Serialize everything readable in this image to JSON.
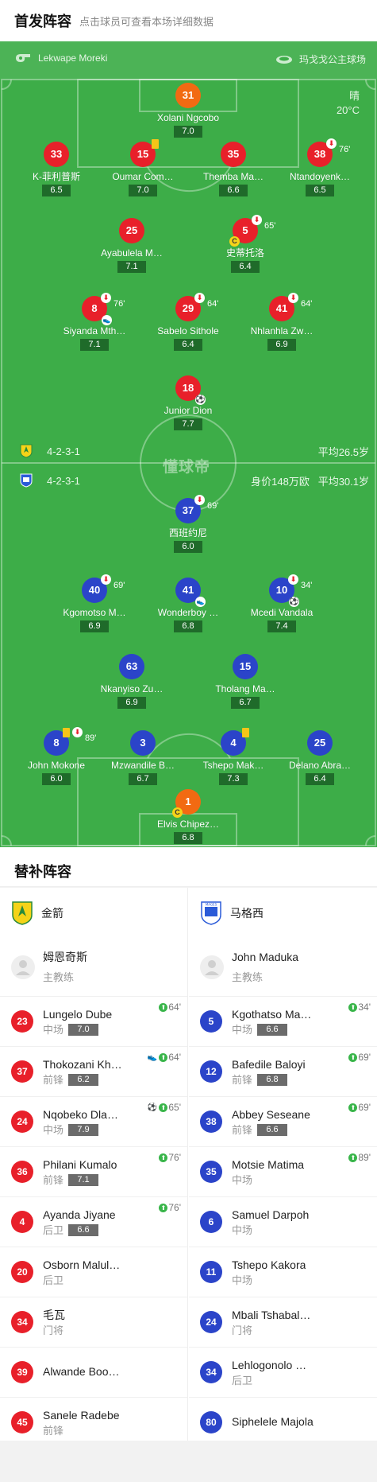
{
  "header": {
    "title": "首发阵容",
    "subtitle": "点击球员可查看本场详细数据"
  },
  "match_info": {
    "referee": "Lekwape Moreki",
    "venue": "玛戈戈公主球场",
    "weather": "晴",
    "temperature": "20°C"
  },
  "watermark": "懂球帝",
  "home": {
    "formation": "4-2-3-1",
    "avg_age": "平均26.5岁",
    "color": "#e8202a",
    "players": [
      {
        "no": "31",
        "name": "Xolani Ngcobo",
        "rating": "7.0",
        "gk": true
      },
      {
        "no": "33",
        "name": "K-菲利普斯",
        "rating": "6.5"
      },
      {
        "no": "15",
        "name": "Oumar Com…",
        "rating": "7.0",
        "yellow": true
      },
      {
        "no": "35",
        "name": "Themba Ma…",
        "rating": "6.6"
      },
      {
        "no": "38",
        "name": "Ntandoyenk…",
        "rating": "6.5",
        "sub_min": "76'"
      },
      {
        "no": "25",
        "name": "Ayabulela M…",
        "rating": "7.1"
      },
      {
        "no": "5",
        "name": "史蒂托洛",
        "rating": "6.4",
        "sub_min": "65'",
        "captain": true
      },
      {
        "no": "8",
        "name": "Siyanda Mth…",
        "rating": "7.1",
        "sub_min": "76'",
        "assist": true
      },
      {
        "no": "29",
        "name": "Sabelo Sithole",
        "rating": "6.4",
        "sub_min": "64'"
      },
      {
        "no": "41",
        "name": "Nhlanhla Zw…",
        "rating": "6.9",
        "sub_min": "64'"
      },
      {
        "no": "18",
        "name": "Junior Dion",
        "rating": "7.7",
        "goal": true
      }
    ]
  },
  "away": {
    "formation": "4-2-3-1",
    "value": "身价148万欧",
    "avg_age": "平均30.1岁",
    "color": "#2b44c9",
    "players": [
      {
        "no": "37",
        "name": "西班约尼",
        "rating": "6.0",
        "sub_min": "69'"
      },
      {
        "no": "40",
        "name": "Kgomotso M…",
        "rating": "6.9",
        "sub_min": "69'"
      },
      {
        "no": "41",
        "name": "Wonderboy …",
        "rating": "6.8",
        "assist": true
      },
      {
        "no": "10",
        "name": "Mcedi Vandala",
        "rating": "7.4",
        "sub_min": "34'",
        "goal": true
      },
      {
        "no": "63",
        "name": "Nkanyiso Zu…",
        "rating": "6.9"
      },
      {
        "no": "15",
        "name": "Tholang Ma…",
        "rating": "6.7"
      },
      {
        "no": "8",
        "name": "John Mokone",
        "rating": "6.0",
        "sub_min": "89'",
        "yellow": true
      },
      {
        "no": "3",
        "name": "Mzwandile B…",
        "rating": "6.7"
      },
      {
        "no": "4",
        "name": "Tshepo Mak…",
        "rating": "7.3",
        "yellow": true
      },
      {
        "no": "25",
        "name": "Delano Abra…",
        "rating": "6.4"
      },
      {
        "no": "1",
        "name": "Elvis Chipez…",
        "rating": "6.8",
        "gk": true,
        "captain": true
      }
    ]
  },
  "subs_section": {
    "title": "替补阵容"
  },
  "home_bench": {
    "team": "金箭",
    "coach": {
      "name": "姆恩奇斯",
      "role": "主教练"
    },
    "players": [
      {
        "no": "23",
        "name": "Lungelo Dube",
        "pos": "中场",
        "rating": "7.0",
        "min": "64'"
      },
      {
        "no": "37",
        "name": "Thokozani Kh…",
        "pos": "前锋",
        "rating": "6.2",
        "min": "64'",
        "assist": true
      },
      {
        "no": "24",
        "name": "Nqobeko Dla…",
        "pos": "中场",
        "rating": "7.9",
        "min": "65'",
        "goal": true
      },
      {
        "no": "36",
        "name": "Philani Kumalo",
        "pos": "前锋",
        "rating": "7.1",
        "min": "76'"
      },
      {
        "no": "4",
        "name": "Ayanda Jiyane",
        "pos": "后卫",
        "rating": "6.6",
        "min": "76'"
      },
      {
        "no": "20",
        "name": "Osborn Malul…",
        "pos": "后卫"
      },
      {
        "no": "34",
        "name": "毛瓦",
        "pos": "门将"
      },
      {
        "no": "39",
        "name": "Alwande Boo…",
        "pos": ""
      },
      {
        "no": "45",
        "name": "Sanele Radebe",
        "pos": "前锋"
      }
    ]
  },
  "away_bench": {
    "team": "马格西",
    "coach": {
      "name": "John Maduka",
      "role": "主教练"
    },
    "players": [
      {
        "no": "5",
        "name": "Kgothatso Ma…",
        "pos": "中场",
        "rating": "6.6",
        "min": "34'"
      },
      {
        "no": "12",
        "name": "Bafedile Baloyi",
        "pos": "前锋",
        "rating": "6.8",
        "min": "69'"
      },
      {
        "no": "38",
        "name": "Abbey Seseane",
        "pos": "前锋",
        "rating": "6.6",
        "min": "69'"
      },
      {
        "no": "35",
        "name": "Motsie Matima",
        "pos": "中场",
        "min": "89'"
      },
      {
        "no": "6",
        "name": "Samuel Darpoh",
        "pos": "中场"
      },
      {
        "no": "11",
        "name": "Tshepo Kakora",
        "pos": "中场"
      },
      {
        "no": "24",
        "name": "Mbali Tshabal…",
        "pos": "门将"
      },
      {
        "no": "34",
        "name": "Lehlogonolo …",
        "pos": "后卫"
      },
      {
        "no": "80",
        "name": "Siphelele Majola",
        "pos": ""
      }
    ]
  }
}
